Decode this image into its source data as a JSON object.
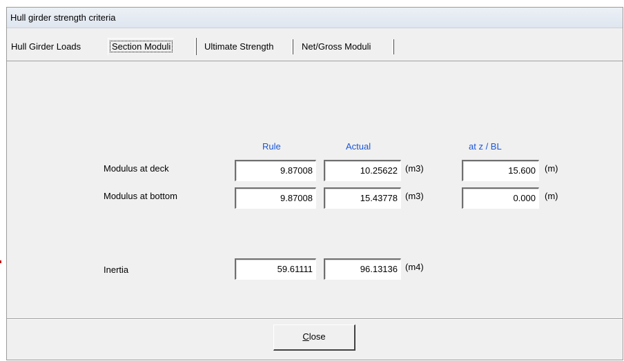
{
  "window": {
    "title": "Hull girder strength criteria"
  },
  "tabs": [
    {
      "label": "Hull Girder Loads",
      "active": false
    },
    {
      "label": "Section Moduli",
      "active": true
    },
    {
      "label": "Ultimate Strength",
      "active": false
    },
    {
      "label": "Net/Gross Moduli",
      "active": false
    }
  ],
  "columns": {
    "rule": "Rule",
    "actual": "Actual",
    "at_z": "at z / BL"
  },
  "rows": {
    "deck": {
      "label": "Modulus at deck",
      "rule": "9.87008",
      "actual": "10.25622",
      "actual_unit": "(m3)",
      "at_z": "15.600",
      "at_z_unit": "(m)"
    },
    "bottom": {
      "label": "Modulus at bottom",
      "rule": "9.87008",
      "actual": "15.43778",
      "actual_unit": "(m3)",
      "at_z": "0.000",
      "at_z_unit": "(m)"
    },
    "inertia": {
      "label": "Inertia",
      "rule": "59.61111",
      "actual": "96.13136",
      "actual_unit": "(m4)"
    }
  },
  "buttons": {
    "close_prefix": "",
    "close_mnemonic": "C",
    "close_rest": "lose"
  },
  "colors": {
    "header_text": "#1a56d6"
  }
}
